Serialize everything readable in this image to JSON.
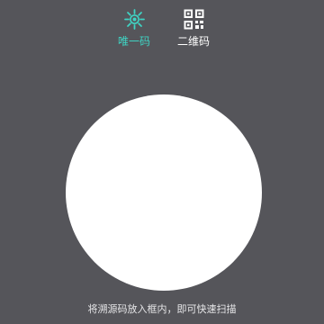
{
  "tabs": [
    {
      "label": "唯一码",
      "icon": "unique-code-icon",
      "active": true
    },
    {
      "label": "二维码",
      "icon": "qr-code-icon",
      "active": false
    }
  ],
  "scanner": {
    "hint": "将溯源码放入框内，即可快速扫描"
  },
  "colors": {
    "background": "#55555a",
    "accent": "#3fd3c3",
    "circle": "#ffffff",
    "text": "#ffffff"
  }
}
